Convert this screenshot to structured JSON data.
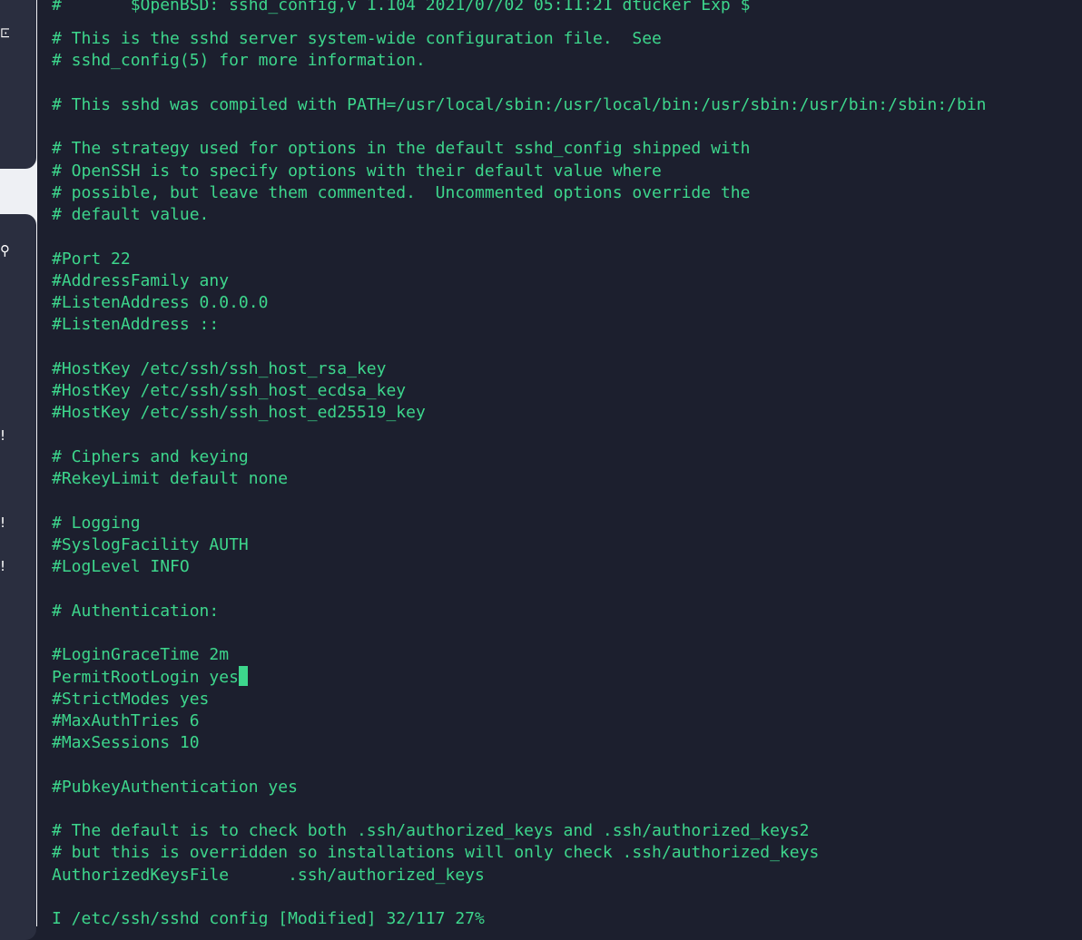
{
  "sidebar": {
    "icons": [
      {
        "name": "window-icon",
        "glyph": "⊡"
      },
      {
        "name": "search-icon",
        "glyph": "⚲"
      },
      {
        "name": "alert-icon-1",
        "glyph": "!"
      },
      {
        "name": "alert-icon-2",
        "glyph": "!"
      },
      {
        "name": "alert-icon-3",
        "glyph": "!"
      }
    ]
  },
  "editor": {
    "partial_top_line": "#       $OpenBSD: sshd_config,v 1.104 2021/07/02 05:11:21 dtucker Exp $",
    "lines": [
      "# This is the sshd server system-wide configuration file.  See",
      "# sshd_config(5) for more information.",
      "",
      "# This sshd was compiled with PATH=/usr/local/sbin:/usr/local/bin:/usr/sbin:/usr/bin:/sbin:/bin",
      "",
      "# The strategy used for options in the default sshd_config shipped with",
      "# OpenSSH is to specify options with their default value where",
      "# possible, but leave them commented.  Uncommented options override the",
      "# default value.",
      "",
      "#Port 22",
      "#AddressFamily any",
      "#ListenAddress 0.0.0.0",
      "#ListenAddress ::",
      "",
      "#HostKey /etc/ssh/ssh_host_rsa_key",
      "#HostKey /etc/ssh/ssh_host_ecdsa_key",
      "#HostKey /etc/ssh/ssh_host_ed25519_key",
      "",
      "# Ciphers and keying",
      "#RekeyLimit default none",
      "",
      "# Logging",
      "#SyslogFacility AUTH",
      "#LogLevel INFO",
      "",
      "# Authentication:",
      "",
      "#LoginGraceTime 2m",
      "PermitRootLogin yes",
      "#StrictModes yes",
      "#MaxAuthTries 6",
      "#MaxSessions 10",
      "",
      "#PubkeyAuthentication yes",
      "",
      "# The default is to check both .ssh/authorized_keys and .ssh/authorized_keys2",
      "# but this is overridden so installations will only check .ssh/authorized_keys",
      "AuthorizedKeysFile      .ssh/authorized_keys"
    ],
    "cursor_line_index": 29,
    "status_line": "I /etc/ssh/sshd_config [Modified] 32/117 27%"
  },
  "colors": {
    "text": "#3dd68c",
    "background": "#1c1f2e",
    "sidebar_panel": "#2a2e3f"
  }
}
